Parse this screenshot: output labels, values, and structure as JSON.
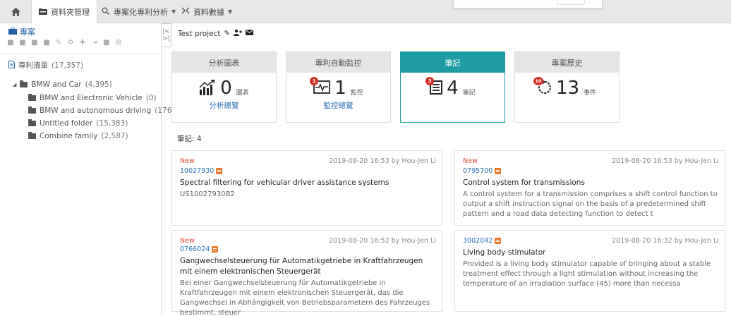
{
  "nav": {
    "tabs": [
      {
        "label": "資料夾管理",
        "icon": "folder-icon"
      },
      {
        "label": "專案化專利分析",
        "icon": "analysis-icon"
      },
      {
        "label": "資料數據",
        "icon": "data-icon"
      }
    ]
  },
  "sidebar": {
    "title": "專案",
    "tree": {
      "root": {
        "label": "專利清單",
        "count": "(17,357)"
      },
      "folder": {
        "label": "BMW and Car",
        "count": "(4,395)"
      },
      "children": [
        {
          "label": "BMW and Electronic Vehicle",
          "count": "(0)"
        },
        {
          "label": "BMW and autonomous driving",
          "count": "(176)"
        },
        {
          "label": "Untitled folder",
          "count": "(15,383)"
        },
        {
          "label": "Combine family",
          "count": "(2,587)"
        }
      ]
    }
  },
  "project": {
    "name": "Test project"
  },
  "cards": [
    {
      "header": "分析圖表",
      "value": "0",
      "unit": "圖表",
      "link": "分析總覽",
      "icon": "chart-icon",
      "badge": ""
    },
    {
      "header": "專利自動監控",
      "value": "1",
      "unit": "監控",
      "link": "監控總覽",
      "icon": "monitor-icon",
      "badge": "1"
    },
    {
      "header": "筆記",
      "value": "4",
      "unit": "筆記",
      "link": "",
      "icon": "note-icon",
      "badge": "3"
    },
    {
      "header": "專案歷史",
      "value": "13",
      "unit": "事件",
      "link": "",
      "icon": "history-icon",
      "badge": "10"
    }
  ],
  "notes_count_label": "筆記: 4",
  "notes": [
    {
      "is_new": "New",
      "meta": "2019-08-20 16:53 by Hou-Jen Li",
      "number": "10027930",
      "title": "Spectral filtering for vehicular driver assistance systems",
      "desc": "US10027930B2"
    },
    {
      "is_new": "New",
      "meta": "2019-08-20 16:53 by Hou-Jen Li",
      "number": "0795700",
      "title": "Control system for transmissions",
      "desc": "A control system for a transmission comprises a shift control function to output a shift instruction signal on the basis of a predetermined shift pattern and a road data detecting function to detect t"
    },
    {
      "is_new": "New",
      "meta": "2019-08-20 16:52 by Hou-Jen Li",
      "number": "0766024",
      "title": "Gangwechselsteuerung für Automatikgetriebe in Kraftfahrzeugen mit einem elektronischen Steuergerät",
      "desc": "Bei einer Gangwechselsteuerung für Automatikgetriebe in Kraftfahrzeugen mit einem elektronischen Steuergerät, das die Gangwechsel in Abhängigkeit von Betriebsparametern des Fahrzeuges bestimmt, steuer"
    },
    {
      "is_new": "",
      "meta": "2019-08-20 16:32 by Hou-Jen Li",
      "number": "3002042",
      "title": "Living body stimulator",
      "desc": "Provided is a living body stimulator capable of bringing about a stable treatment effect through a light stimulation without increasing the temperature of an irradiation surface (45) more than necessa"
    }
  ],
  "colors": {
    "accent": "#1e9ba3",
    "link": "#2a6fb5",
    "new": "#e0443a",
    "badge": "#d93025"
  }
}
